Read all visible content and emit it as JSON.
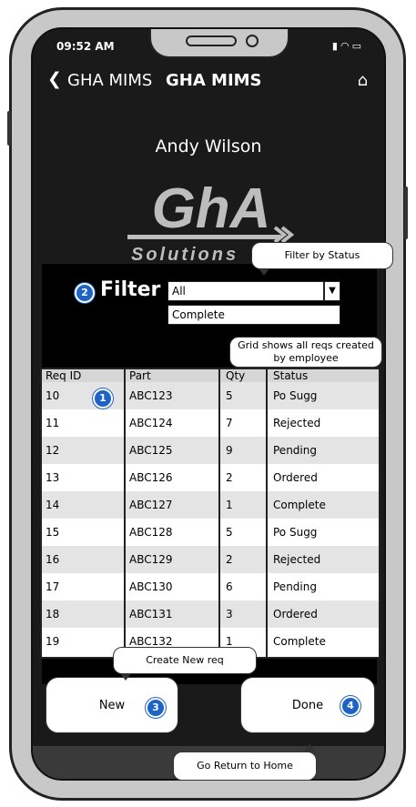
{
  "status_bar": {
    "time": "09:52 AM",
    "icons": [
      "signal-icon",
      "wifi-icon",
      "battery-icon"
    ]
  },
  "nav": {
    "back_label": "GHA MIMS",
    "title": "GHA MIMS",
    "home_icon": "home-icon"
  },
  "user": {
    "name": "Andy Wilson"
  },
  "logo": {
    "line1": "GhA",
    "line2": "Solutions"
  },
  "filter": {
    "badge": "2",
    "label": "Filter",
    "selected": "All",
    "option": "Complete"
  },
  "grid": {
    "badge": "1",
    "columns": [
      "Req ID",
      "Part",
      "Qty",
      "Status"
    ],
    "rows": [
      [
        "10",
        "ABC123",
        "5",
        "Po Sugg"
      ],
      [
        "11",
        "ABC124",
        "7",
        "Rejected"
      ],
      [
        "12",
        "ABC125",
        "9",
        "Pending"
      ],
      [
        "13",
        "ABC126",
        "2",
        "Ordered"
      ],
      [
        "14",
        "ABC127",
        "1",
        "Complete"
      ],
      [
        "15",
        "ABC128",
        "5",
        "Po Sugg"
      ],
      [
        "16",
        "ABC129",
        "2",
        "Rejected"
      ],
      [
        "17",
        "ABC130",
        "6",
        "Pending"
      ],
      [
        "18",
        "ABC131",
        "3",
        "Ordered"
      ],
      [
        "19",
        "ABC132",
        "1",
        "Complete"
      ]
    ]
  },
  "buttons": {
    "new_label": "New",
    "new_badge": "3",
    "done_label": "Done",
    "done_badge": "4"
  },
  "callouts": {
    "filter": "Filter by Status",
    "grid": "Grid shows all reqs created by employee",
    "new": "Create New req",
    "home": "Go Return to Home"
  },
  "colors": {
    "badge": "#1e63c6",
    "screen": "#1a1a1a"
  }
}
